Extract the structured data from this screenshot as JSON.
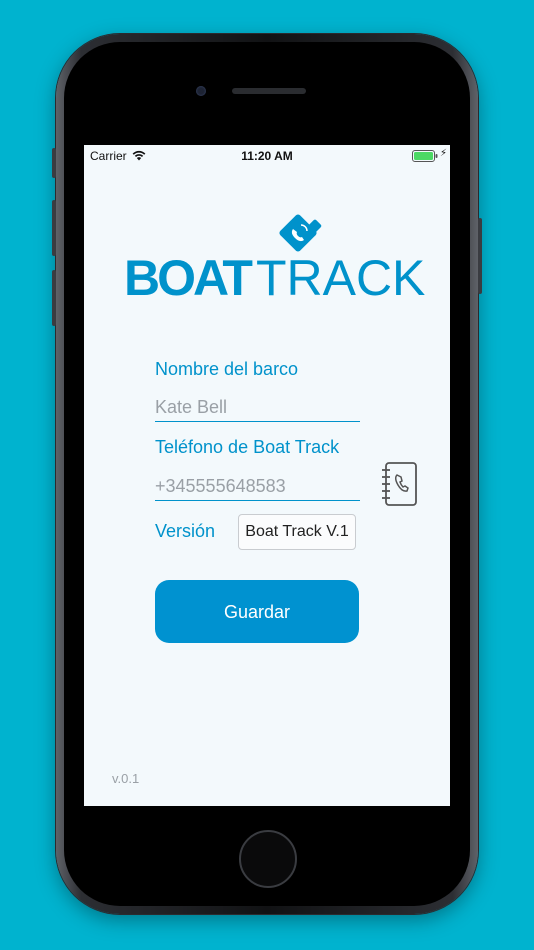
{
  "status_bar": {
    "carrier": "Carrier",
    "time": "11:20 AM",
    "icons": [
      "wifi-icon",
      "battery-icon",
      "charging-bolt-icon"
    ]
  },
  "logo": {
    "word_bold": "BOAT",
    "word_light": "TRACK",
    "icon": "boat-phone-logo-icon"
  },
  "form": {
    "boat_name_label": "Nombre del barco",
    "boat_name_value": "Kate Bell",
    "phone_label": "Teléfono de Boat Track",
    "phone_value": "+345555648583",
    "contacts_icon": "contacts-book-icon",
    "version_label": "Versión",
    "version_selected": "Boat Track V.1",
    "save_label": "Guardar"
  },
  "app_version": "v.0.1",
  "colors": {
    "background": "#00b3cf",
    "brand_blue": "#0092cb",
    "button_blue": "#0092d0",
    "screen_bg": "#f3f9fc"
  }
}
